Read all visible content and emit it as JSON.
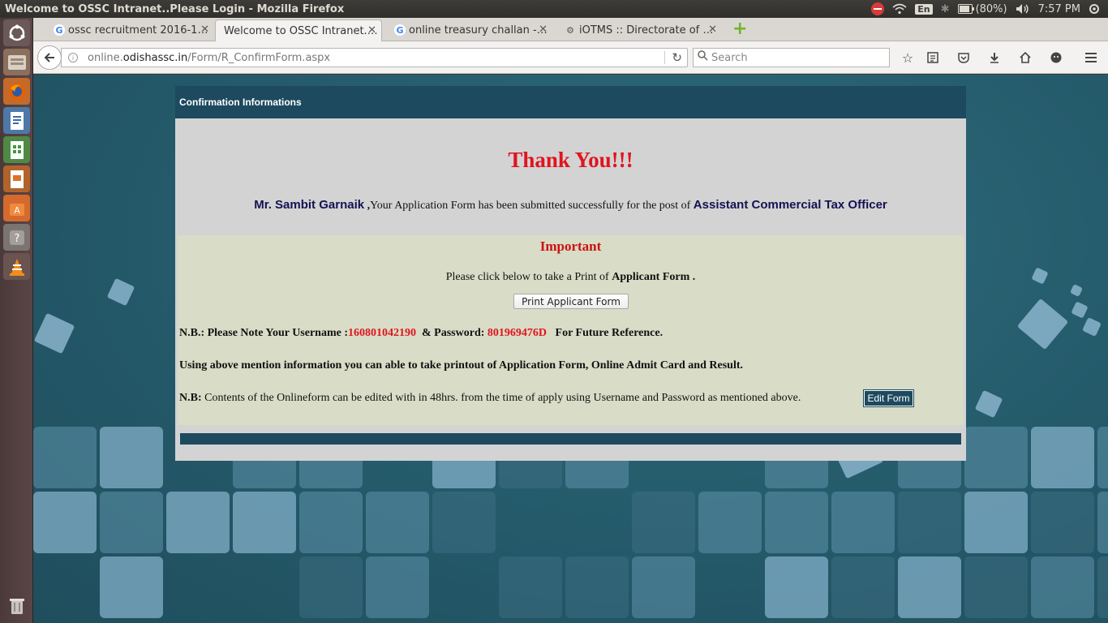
{
  "system": {
    "window_title": "Welcome to OSSC Intranet..Please Login - Mozilla Firefox",
    "keyboard": "En",
    "battery": "(80%)",
    "time": "7:57 PM"
  },
  "tabs": [
    {
      "label": "ossc recruitment 2016-1…",
      "favicon": "google-icon",
      "active": false
    },
    {
      "label": "Welcome to OSSC Intranet.…",
      "favicon": "none",
      "active": true
    },
    {
      "label": "online treasury challan -…",
      "favicon": "google-icon",
      "active": false
    },
    {
      "label": "iOTMS :: Directorate of …",
      "favicon": "gear-icon",
      "active": false
    }
  ],
  "navbar": {
    "url_prefix": "online.",
    "url_host": "odishassc.in",
    "url_path": "/Form/R_ConfirmForm.aspx",
    "search_placeholder": "Search"
  },
  "page": {
    "header": "Confirmation Informations",
    "thanks": "Thank You!!!",
    "salutation": "Mr. Sambit Garnaik",
    "submitted_text": "Your  Application Form has been submitted successfully for the post of",
    "post": "Assistant Commercial Tax Officer",
    "important_title": "Important",
    "print_prefix": "Please click below to take a Print of",
    "print_strong": "Applicant Form .",
    "print_button": "Print Applicant Form",
    "nb_prefix": "N.B.: Please Note Your Username :",
    "username": "160801042190",
    "password_label": " & Password:",
    "password": "801969476D",
    "nb_suffix": " For Future Reference.",
    "using_text": "Using above mention information you can able to take printout of Application Form, Online Admit Card and Result.",
    "nb3_label": "N.B:",
    "nb3_text": " Contents of the Onlineform can be edited with in 48hrs. from the time of apply using Username and Password as mentioned above.",
    "edit_button": "Edit Form"
  },
  "colors": {
    "panel_header": "#1d4a5f",
    "thanks_red": "#e0141e",
    "important_bg": "#d9dcc6"
  }
}
